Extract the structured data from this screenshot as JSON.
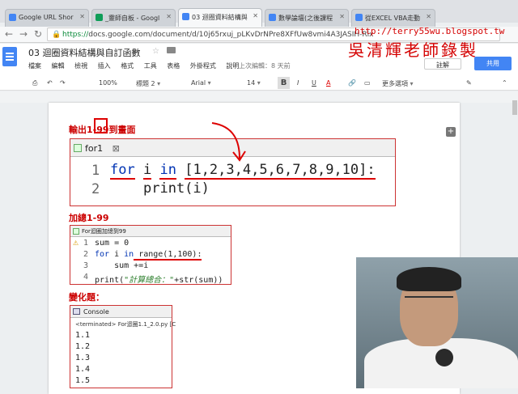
{
  "browser": {
    "tabs": [
      {
        "label": "Google URL Shor",
        "color": "#4285f4"
      },
      {
        "label": "_靈師自板 - Googl",
        "color": "#0f9d58"
      },
      {
        "label": "03 迴圈資料結構與",
        "color": "#4285f4"
      },
      {
        "label": "數學論壇(之後課程",
        "color": "#4285f4"
      },
      {
        "label": "從EXCEL VBA走動",
        "color": "#4285f4"
      }
    ],
    "url_scheme": "https://",
    "url_rest": "docs.google.com/document/d/10j65rxuj_pLKvDrNPre8XFfUw8vmi4A3JASIH-Rix"
  },
  "docs": {
    "title": "03 迴圈資料結構與自訂函數",
    "menu": [
      "檔案",
      "編輯",
      "檢視",
      "插入",
      "格式",
      "工具",
      "表格",
      "外掛程式",
      "說明"
    ],
    "last_edit": "上次編輯：8 天前",
    "comment_label": "註解",
    "share_label": "共用"
  },
  "toolbar": {
    "zoom": "100%",
    "style": "標題 2",
    "font": "Arial",
    "size": "14",
    "bold": "B",
    "italic": "I",
    "underline": "U",
    "color": "A",
    "more": "更多選項"
  },
  "content": {
    "heading1": "輸出1-99到畫面",
    "panel1_tab": "for1",
    "panel1_lines": [
      "1",
      "2"
    ],
    "code1_line1_kw_for": "for",
    "code1_line1_var": "i",
    "code1_line1_kw_in": "in",
    "code1_line1_list": "[1,2,3,4,5,6,7,8,9,10]:",
    "code1_line2": "print(i)",
    "heading2": "加總1-99",
    "panel2_tab": "For迴圈加總到99",
    "panel2_lines": [
      "1",
      "2",
      "3",
      "4"
    ],
    "code2_line1": "sum = 0",
    "code2_line2_kw_for": "for",
    "code2_line2_mid": " i ",
    "code2_line2_kw_in": "in",
    "code2_line2_rest": " range(1,100):",
    "code2_line3": "    sum +=i",
    "code2_line4_a": "print(",
    "code2_line4_str": "\"計算總合：\"",
    "code2_line4_b": "+str(sum))",
    "heading3": "變化題：",
    "console_tab": "Console",
    "console_status": "<terminated> For迴圈1.1_2.0.py [C",
    "console_output": [
      "1.1",
      "1.2",
      "1.3",
      "1.4",
      "1.5"
    ]
  },
  "watermark": {
    "url": "http://terry55wu.blogspot.tw",
    "name": "吳清輝老師錄製"
  }
}
